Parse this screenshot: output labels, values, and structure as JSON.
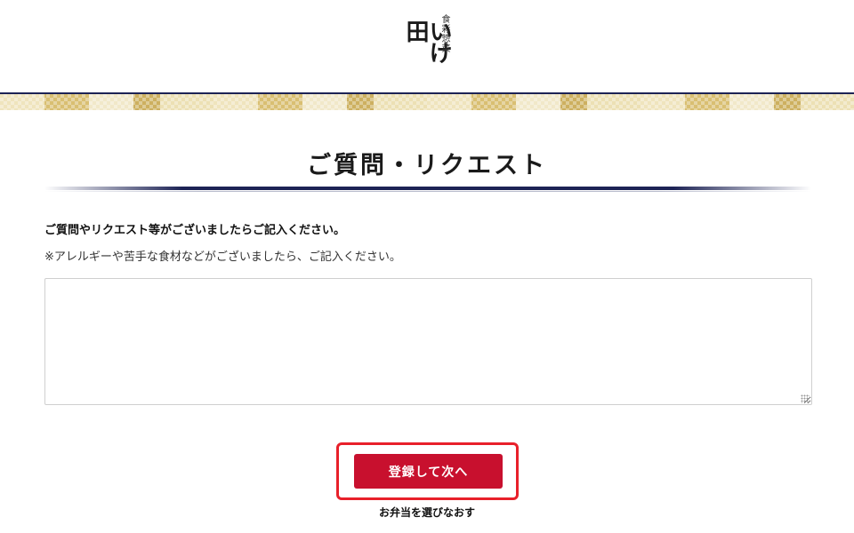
{
  "header": {
    "logo_main": "いけ田",
    "logo_sub": "食彩惣菜"
  },
  "section": {
    "title": "ご質問・リクエスト"
  },
  "form": {
    "instruction": "ご質問やリクエスト等がございましたらご記入ください。",
    "note": "※アレルギーや苦手な食材などがございましたら、ご記入ください。",
    "textarea_value": "",
    "submit_label": "登録して次へ",
    "back_link_label": "お弁当を選びなおす"
  },
  "colors": {
    "accent": "#c8102e",
    "navy": "#1d2355",
    "highlight": "#e8202a",
    "band_gold": "#d9bf72"
  }
}
